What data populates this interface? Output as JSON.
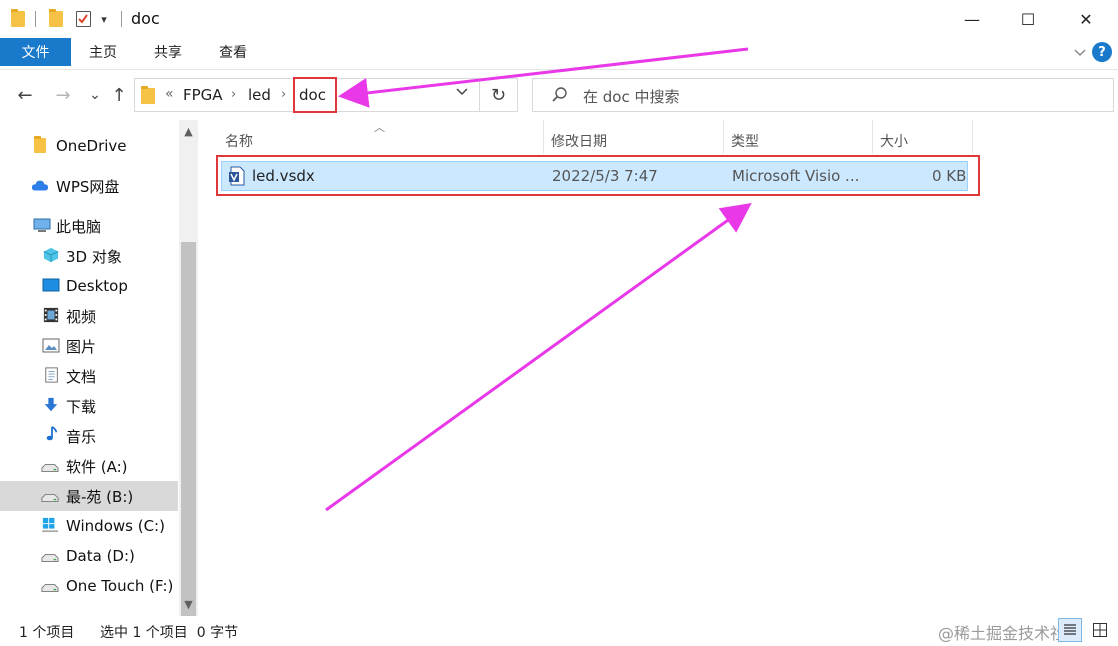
{
  "window": {
    "title": "doc",
    "controls": {
      "minimize": "—",
      "maximize": "☐",
      "close": "✕"
    },
    "quick_access_dropdown": "▾"
  },
  "ribbon": {
    "tabs": [
      {
        "label": "文件"
      },
      {
        "label": "主页"
      },
      {
        "label": "共享"
      },
      {
        "label": "查看"
      }
    ],
    "expand_icon": "chevron-down-icon",
    "help_label": "?"
  },
  "nav": {
    "back": "←",
    "forward": "→",
    "recent": "⌄",
    "up": "↑"
  },
  "address": {
    "overflow": "«",
    "crumbs": [
      "FPGA",
      "led",
      "doc"
    ],
    "separator": "›",
    "dropdown": "⌄",
    "refresh": "↻"
  },
  "search": {
    "placeholder": "在 doc 中搜索"
  },
  "sidebar": {
    "items": [
      {
        "label": "OneDrive",
        "icon": "folder-icon"
      },
      {
        "label": "WPS网盘",
        "icon": "cloud-icon"
      },
      {
        "label": "此电脑",
        "icon": "computer-icon"
      },
      {
        "label": "3D 对象",
        "icon": "cube-icon"
      },
      {
        "label": "Desktop",
        "icon": "desktop-icon"
      },
      {
        "label": "视频",
        "icon": "film-icon"
      },
      {
        "label": "图片",
        "icon": "picture-icon"
      },
      {
        "label": "文档",
        "icon": "document-icon"
      },
      {
        "label": "下载",
        "icon": "download-icon"
      },
      {
        "label": "音乐",
        "icon": "music-icon"
      },
      {
        "label": "软件 (A:)",
        "icon": "drive-icon"
      },
      {
        "label": "最-苑 (B:)",
        "icon": "drive-icon"
      },
      {
        "label": "Windows (C:)",
        "icon": "windows-drive-icon"
      },
      {
        "label": "Data (D:)",
        "icon": "drive-icon"
      },
      {
        "label": "One Touch (F:)",
        "icon": "drive-icon"
      }
    ],
    "selected_index": 11
  },
  "columns": [
    "名称",
    "修改日期",
    "类型",
    "大小"
  ],
  "files": [
    {
      "name": "led.vsdx",
      "modified": "2022/5/3 7:47",
      "type": "Microsoft Visio ...",
      "size": "0 KB",
      "icon": "visio-file-icon"
    }
  ],
  "status": {
    "count": "1 个项目",
    "selection": "选中 1 个项目  0 字节"
  },
  "watermark": "@稀土掘金技术社区",
  "colors": {
    "accent": "#1979ca",
    "selection_bg": "#cce8ff",
    "highlight_box": "#e0373a",
    "annotation_arrow": "#e838e8"
  }
}
